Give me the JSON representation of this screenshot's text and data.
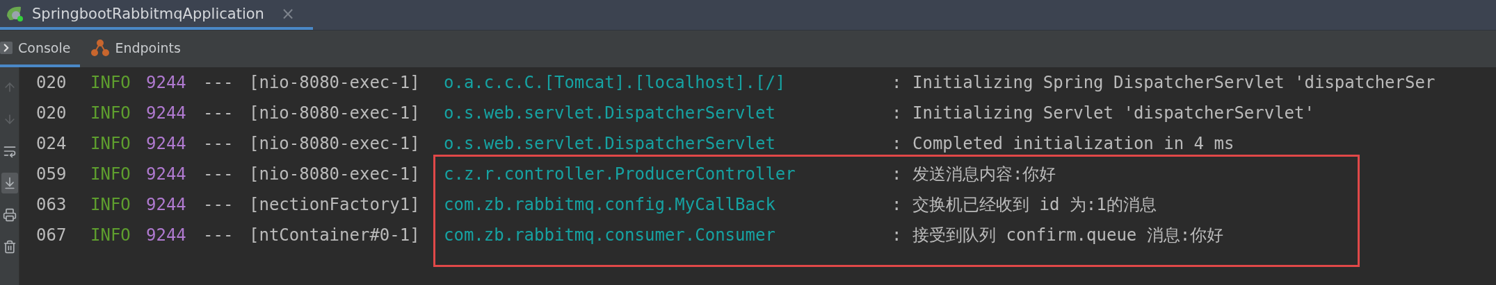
{
  "run_tab": {
    "title": "SpringbootRabbitmqApplication",
    "close": "×",
    "selected": true
  },
  "tool_tabs": [
    {
      "label": "Console",
      "kind": "console",
      "selected": true
    },
    {
      "label": "Endpoints",
      "kind": "endpoints",
      "selected": false
    }
  ],
  "gutter": [
    {
      "kind": "up",
      "disabled": true,
      "selected": false
    },
    {
      "kind": "down",
      "disabled": true,
      "selected": false
    },
    {
      "kind": "wrap",
      "disabled": false,
      "selected": false
    },
    {
      "kind": "scroll",
      "disabled": false,
      "selected": true
    },
    {
      "kind": "print",
      "disabled": false,
      "selected": false
    },
    {
      "kind": "trash",
      "disabled": false,
      "selected": false
    }
  ],
  "log": [
    {
      "time": "020",
      "level": "INFO",
      "pid": "9244",
      "sep": "---",
      "thread": "[nio-8080-exec-1]",
      "logger": "o.a.c.c.C.[Tomcat].[localhost].[/]",
      "colon": ":",
      "message": "Initializing Spring DispatcherServlet 'dispatcherSer",
      "highlighted": false
    },
    {
      "time": "020",
      "level": "INFO",
      "pid": "9244",
      "sep": "---",
      "thread": "[nio-8080-exec-1]",
      "logger": "o.s.web.servlet.DispatcherServlet",
      "colon": ":",
      "message": "Initializing Servlet 'dispatcherServlet'",
      "highlighted": false
    },
    {
      "time": "024",
      "level": "INFO",
      "pid": "9244",
      "sep": "---",
      "thread": "[nio-8080-exec-1]",
      "logger": "o.s.web.servlet.DispatcherServlet",
      "colon": ":",
      "message": "Completed initialization in 4 ms",
      "highlighted": false
    },
    {
      "time": "059",
      "level": "INFO",
      "pid": "9244",
      "sep": "---",
      "thread": "[nio-8080-exec-1]",
      "logger": "c.z.r.controller.ProducerController",
      "colon": ":",
      "message": "发送消息内容:你好",
      "highlighted": true
    },
    {
      "time": "063",
      "level": "INFO",
      "pid": "9244",
      "sep": "---",
      "thread": "[nectionFactory1]",
      "logger": "com.zb.rabbitmq.config.MyCallBack",
      "colon": ":",
      "message": "交换机已经收到 id 为:1的消息",
      "highlighted": true
    },
    {
      "time": "067",
      "level": "INFO",
      "pid": "9244",
      "sep": "---",
      "thread": "[ntContainer#0-1]",
      "logger": "com.zb.rabbitmq.consumer.Consumer",
      "colon": ":",
      "message": "接受到队列 confirm.queue 消息:你好",
      "highlighted": true
    }
  ],
  "highlight": {
    "color": "#e04848"
  }
}
